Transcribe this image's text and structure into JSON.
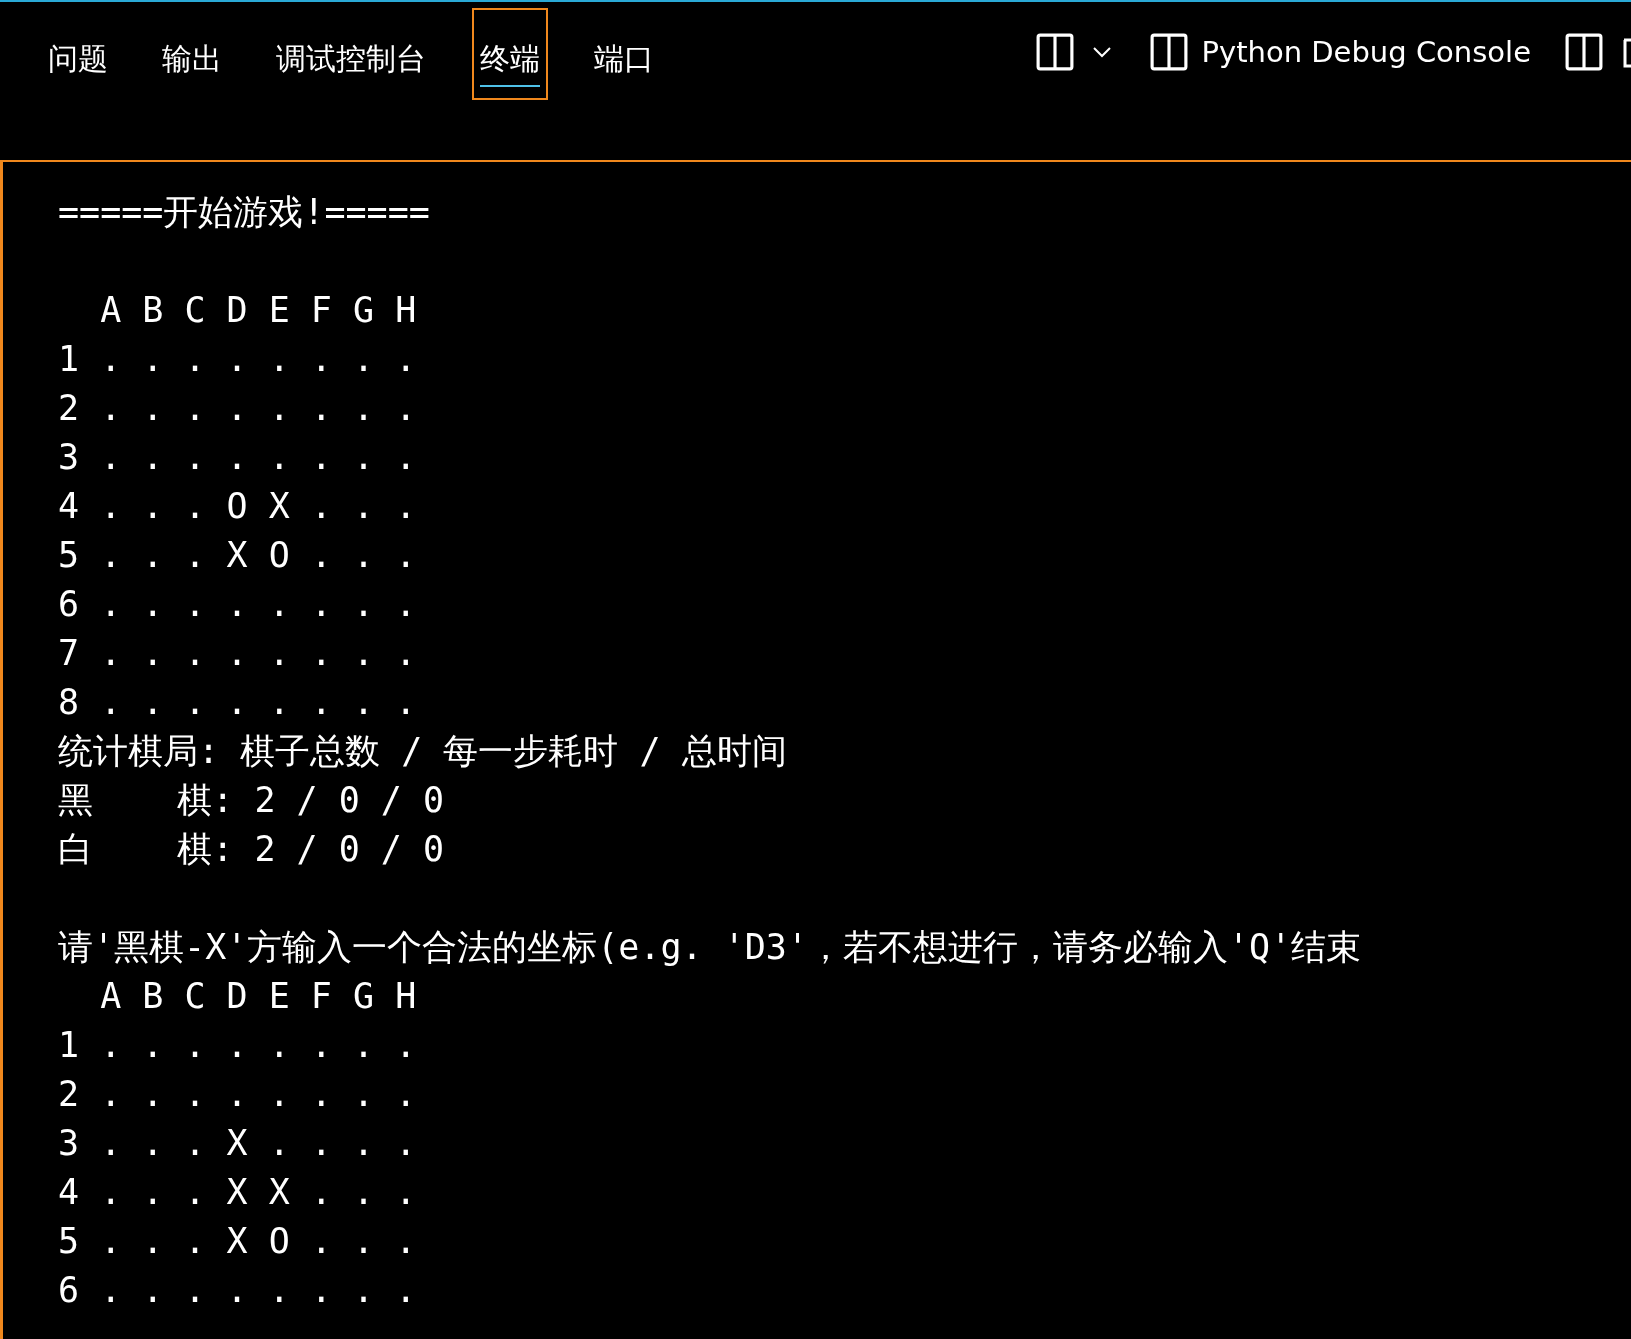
{
  "tabs": [
    {
      "label": "问题",
      "selected": false
    },
    {
      "label": "输出",
      "selected": false
    },
    {
      "label": "调试控制台",
      "selected": false
    },
    {
      "label": "终端",
      "selected": true
    },
    {
      "label": "端口",
      "selected": false
    }
  ],
  "terminal_name": "Python Debug Console",
  "terminal_blocks": [
    [
      "=====开始游戏!====="
    ],
    [
      "  A B C D E F G H",
      "1 . . . . . . . .",
      "2 . . . . . . . .",
      "3 . . . . . . . .",
      "4 . . . O X . . .",
      "5 . . . X O . . .",
      "6 . . . . . . . .",
      "7 . . . . . . . .",
      "8 . . . . . . . .",
      "统计棋局: 棋子总数 / 每一步耗时 / 总时间",
      "黑    棋: 2 / 0 / 0",
      "白    棋: 2 / 0 / 0"
    ],
    [
      "请'黑棋-X'方输入一个合法的坐标(e.g. 'D3'，若不想进行，请务必输入'Q'结束",
      "  A B C D E F G H",
      "1 . . . . . . . .",
      "2 . . . . . . . .",
      "3 . . . X . . . .",
      "4 . . . X X . . .",
      "5 . . . X O . . .",
      "6 . . . . . . . ."
    ]
  ]
}
